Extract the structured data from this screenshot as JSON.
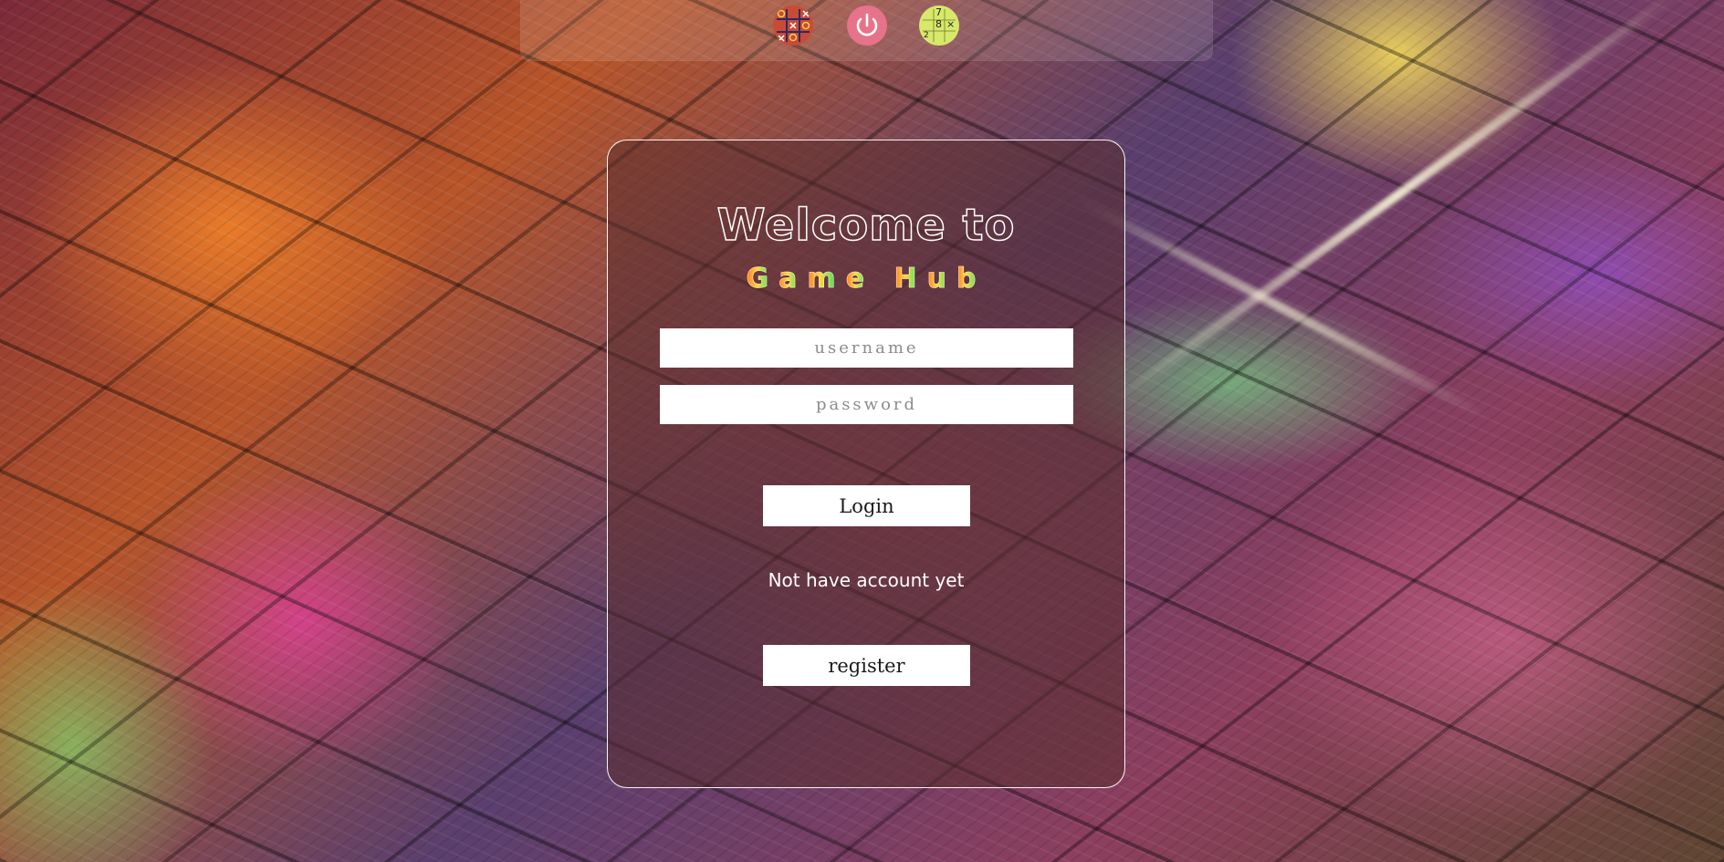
{
  "nav": {
    "icons": [
      {
        "name": "tic-tac-toe-icon",
        "color": "#c94b35"
      },
      {
        "name": "power-icon",
        "color": "#e6738a"
      },
      {
        "name": "sudoku-icon",
        "color": "#d7e86a",
        "digits": [
          "7",
          "8",
          "2",
          "×"
        ]
      }
    ]
  },
  "login": {
    "welcome": "Welcome to",
    "hub_letters": [
      "G",
      "a",
      "m",
      "e",
      " ",
      "H",
      "u",
      "b"
    ],
    "username_placeholder": "username",
    "password_placeholder": "password",
    "login_label": "Login",
    "note": "Not have account yet",
    "register_label": "register"
  },
  "colors": {
    "card_border": "#ffffff",
    "button_bg": "#ffffff",
    "title_gradient": [
      "#ff7a2a",
      "#ffd83a",
      "#62e35c",
      "#2bb58f"
    ]
  }
}
